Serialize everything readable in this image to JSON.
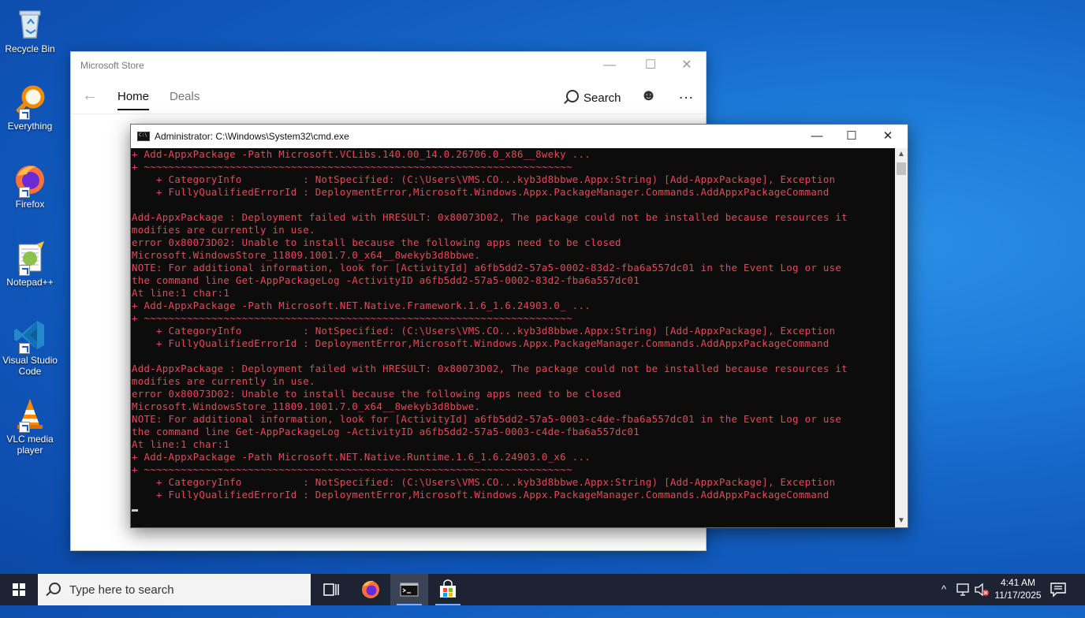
{
  "desktop": {
    "icons": [
      {
        "label_lines": [
          "Recycle Bin"
        ],
        "icon": "recycle-bin-icon"
      },
      {
        "label_lines": [
          "Everything"
        ],
        "icon": "everything-search-icon"
      },
      {
        "label_lines": [
          "Firefox"
        ],
        "icon": "firefox-icon"
      },
      {
        "label_lines": [
          "Notepad++"
        ],
        "icon": "notepad-plus-plus-icon"
      },
      {
        "label_lines": [
          "Visual Studio",
          "Code"
        ],
        "icon": "vscode-icon"
      },
      {
        "label_lines": [
          "VLC media",
          "player"
        ],
        "icon": "vlc-icon"
      }
    ]
  },
  "store": {
    "title": "Microsoft Store",
    "tabs": [
      {
        "label": "Home",
        "active": true
      },
      {
        "label": "Deals",
        "active": false
      }
    ],
    "search_label": "Search"
  },
  "cmd": {
    "title": "Administrator: C:\\Windows\\System32\\cmd.exe",
    "text_color": "#e74856",
    "lines": [
      "+ Add-AppxPackage -Path Microsoft.VCLibs.140.00_14.0.26706.0_x86__8weky ...",
      "+ ~~~~~~~~~~~~~~~~~~~~~~~~~~~~~~~~~~~~~~~~~~~~~~~~~~~~~~~~~~~~~~~~~~~~~~",
      "    + CategoryInfo          : NotSpecified: (C:\\Users\\VMS.CO...kyb3d8bbwe.Appx:String) [Add-AppxPackage], Exception",
      "    + FullyQualifiedErrorId : DeploymentError,Microsoft.Windows.Appx.PackageManager.Commands.AddAppxPackageCommand",
      "",
      "Add-AppxPackage : Deployment failed with HRESULT: 0x80073D02, The package could not be installed because resources it",
      "modifies are currently in use.",
      "error 0x80073D02: Unable to install because the following apps need to be closed",
      "Microsoft.WindowsStore_11809.1001.7.0_x64__8wekyb3d8bbwe.",
      "NOTE: For additional information, look for [ActivityId] a6fb5dd2-57a5-0002-83d2-fba6a557dc01 in the Event Log or use",
      "the command line Get-AppPackageLog -ActivityID a6fb5dd2-57a5-0002-83d2-fba6a557dc01",
      "At line:1 char:1",
      "+ Add-AppxPackage -Path Microsoft.NET.Native.Framework.1.6_1.6.24903.0_ ...",
      "+ ~~~~~~~~~~~~~~~~~~~~~~~~~~~~~~~~~~~~~~~~~~~~~~~~~~~~~~~~~~~~~~~~~~~~~~",
      "    + CategoryInfo          : NotSpecified: (C:\\Users\\VMS.CO...kyb3d8bbwe.Appx:String) [Add-AppxPackage], Exception",
      "    + FullyQualifiedErrorId : DeploymentError,Microsoft.Windows.Appx.PackageManager.Commands.AddAppxPackageCommand",
      "",
      "Add-AppxPackage : Deployment failed with HRESULT: 0x80073D02, The package could not be installed because resources it",
      "modifies are currently in use.",
      "error 0x80073D02: Unable to install because the following apps need to be closed",
      "Microsoft.WindowsStore_11809.1001.7.0_x64__8wekyb3d8bbwe.",
      "NOTE: For additional information, look for [ActivityId] a6fb5dd2-57a5-0003-c4de-fba6a557dc01 in the Event Log or use",
      "the command line Get-AppPackageLog -ActivityID a6fb5dd2-57a5-0003-c4de-fba6a557dc01",
      "At line:1 char:1",
      "+ Add-AppxPackage -Path Microsoft.NET.Native.Runtime.1.6_1.6.24903.0_x6 ...",
      "+ ~~~~~~~~~~~~~~~~~~~~~~~~~~~~~~~~~~~~~~~~~~~~~~~~~~~~~~~~~~~~~~~~~~~~~~",
      "    + CategoryInfo          : NotSpecified: (C:\\Users\\VMS.CO...kyb3d8bbwe.Appx:String) [Add-AppxPackage], Exception",
      "    + FullyQualifiedErrorId : DeploymentError,Microsoft.Windows.Appx.PackageManager.Commands.AddAppxPackageCommand"
    ]
  },
  "taskbar": {
    "search_placeholder": "Type here to search",
    "pinned": [
      {
        "icon": "task-view-icon",
        "active": false,
        "running": false
      },
      {
        "icon": "firefox-icon",
        "active": false,
        "running": false
      },
      {
        "icon": "cmd-icon",
        "active": true,
        "running": true
      },
      {
        "icon": "microsoft-store-icon",
        "active": false,
        "running": true
      }
    ],
    "clock": {
      "time": "4:41 AM",
      "date": "11/17/2025"
    }
  },
  "colors": {
    "desktop_blue": "#1667c9",
    "taskbar": "#1c2434",
    "console_bg": "#0c0c0c",
    "console_error_text": "#e74856"
  }
}
